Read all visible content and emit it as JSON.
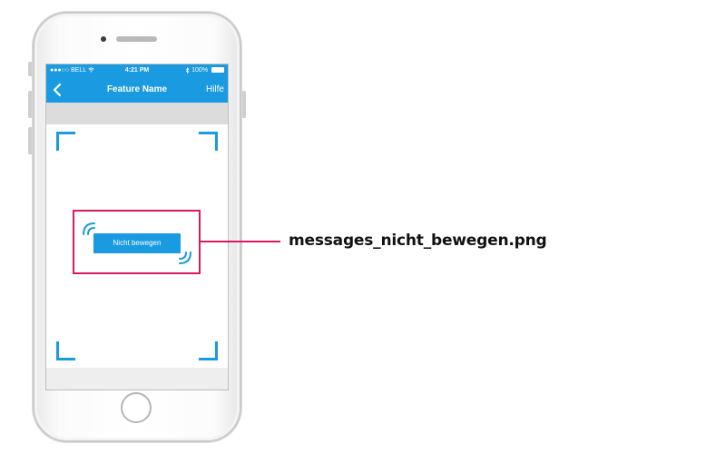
{
  "status_bar": {
    "carrier": "●●●○○ BELL",
    "time": "4:21 PM",
    "battery": "100%"
  },
  "nav_bar": {
    "title": "Feature Name",
    "help_label": "Hilfe"
  },
  "message": {
    "label": "Nicht bewegen"
  },
  "annotation": {
    "filename": "messages_nicht_bewegen.png"
  },
  "colors": {
    "accent": "#1a9ae0",
    "highlight": "#d81b60"
  }
}
